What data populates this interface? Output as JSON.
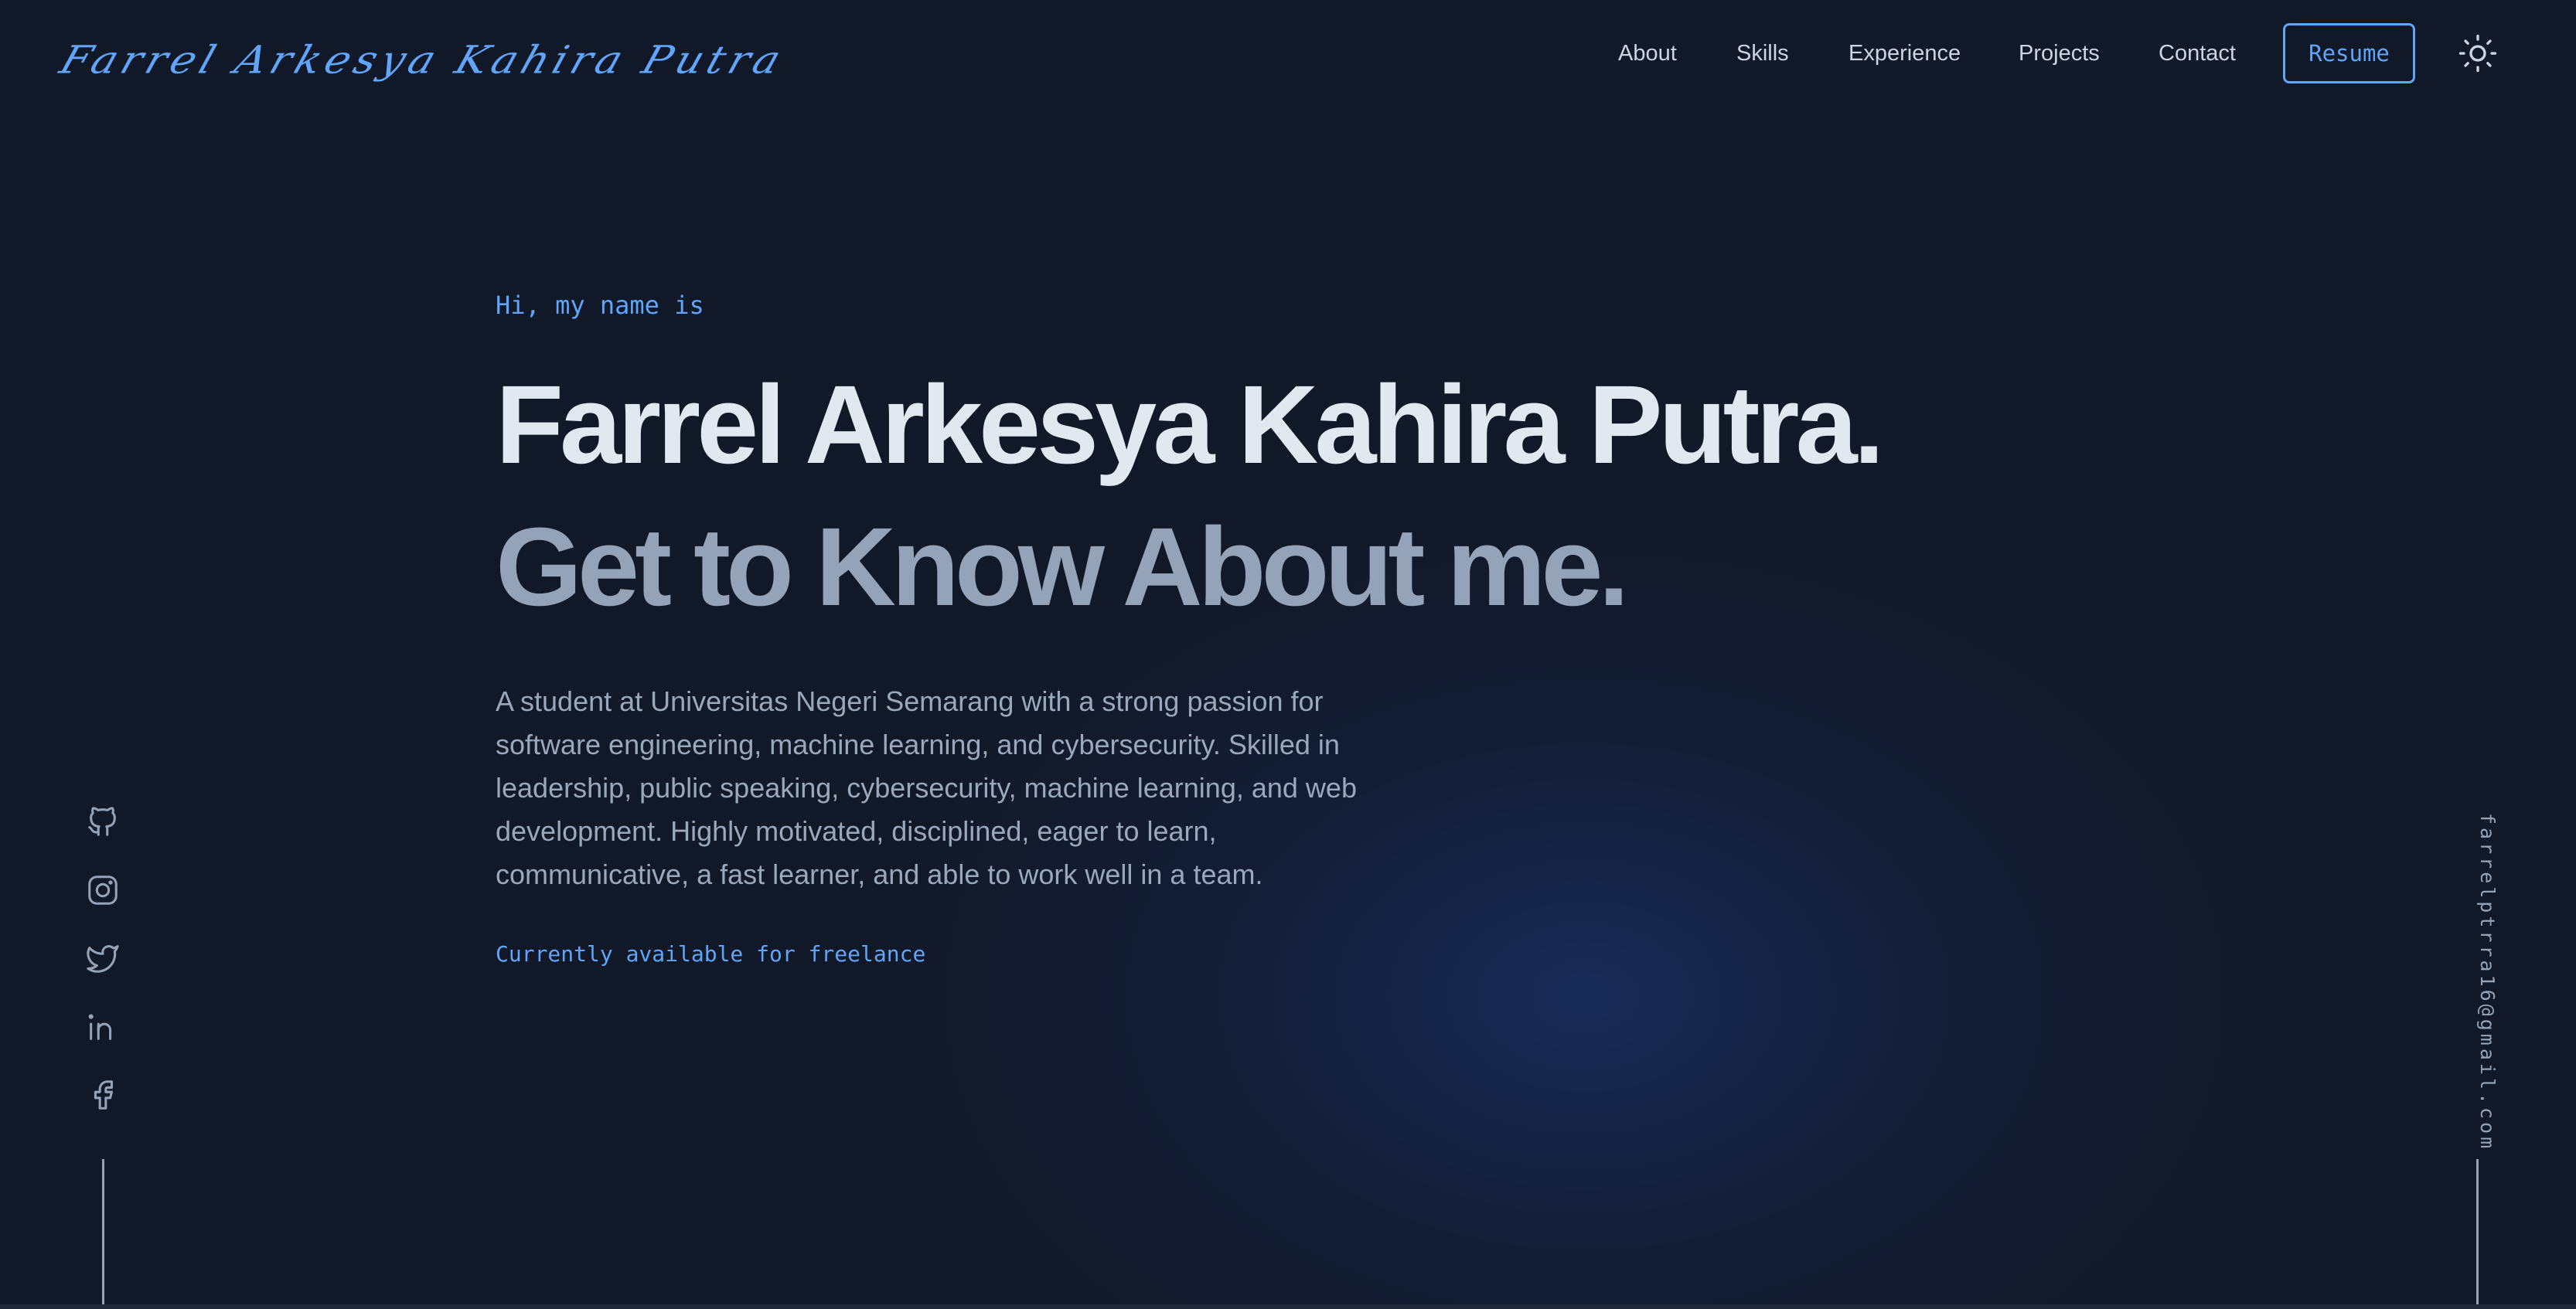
{
  "header": {
    "logo_text": "Farrel Arkesya Kahira Putra",
    "nav": [
      {
        "label": "About"
      },
      {
        "label": "Skills"
      },
      {
        "label": "Experience"
      },
      {
        "label": "Projects"
      },
      {
        "label": "Contact"
      }
    ],
    "resume_label": "Resume",
    "theme_icon": "sun-icon"
  },
  "hero": {
    "greeting": "Hi, my name is",
    "name": "Farrel Arkesya Kahira Putra.",
    "tagline": "Get to Know About me.",
    "bio": "A student at Universitas Negeri Semarang with a strong passion for software engineering, machine learning, and cybersecurity. Skilled in leadership, public speaking, cybersecurity, machine learning, and web development. Highly motivated, disciplined, eager to learn, communicative, a fast learner, and able to work well in a team.",
    "availability": "Currently available for freelance"
  },
  "social": [
    {
      "icon": "github-icon"
    },
    {
      "icon": "instagram-icon"
    },
    {
      "icon": "twitter-icon"
    },
    {
      "icon": "linkedin-icon"
    },
    {
      "icon": "facebook-icon"
    }
  ],
  "email": "farrelptrra16@gmail.com",
  "colors": {
    "background": "#111827",
    "accent": "#60a5fa",
    "heading": "#e2e8f0",
    "muted": "#94a3b8"
  }
}
